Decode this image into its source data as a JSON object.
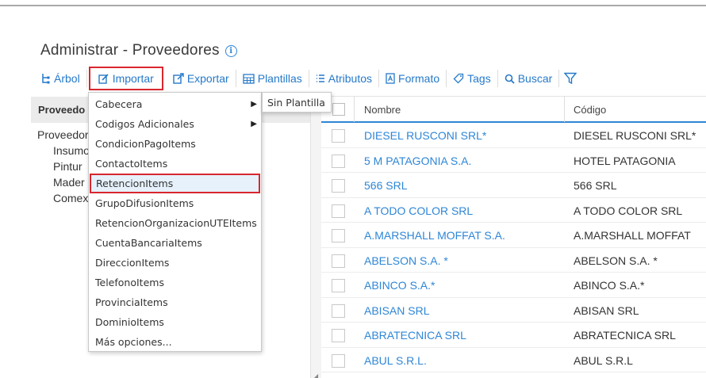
{
  "page": {
    "title": "Administrar - Proveedores"
  },
  "toolbar": {
    "arbol": "Árbol",
    "importar": "Importar",
    "exportar": "Exportar",
    "plantillas": "Plantillas",
    "atributos": "Atributos",
    "formato": "Formato",
    "tags": "Tags",
    "buscar": "Buscar",
    "accent": "#2579c9",
    "highlight": "#d9272e"
  },
  "tree": {
    "header": "Proveedo",
    "root": "Proveedor",
    "children": [
      "Insumo",
      "Pintur",
      "Mader",
      "Comex"
    ]
  },
  "grid": {
    "columns": [
      "Nombre",
      "Código"
    ],
    "rows": [
      {
        "name": "DIESEL RUSCONI SRL*",
        "code": "DIESEL RUSCONI SRL*"
      },
      {
        "name": "5 M PATAGONIA S.A.",
        "code": "HOTEL PATAGONIA"
      },
      {
        "name": "566 SRL",
        "code": "566 SRL"
      },
      {
        "name": "A TODO COLOR SRL",
        "code": "A TODO COLOR SRL"
      },
      {
        "name": "A.MARSHALL MOFFAT S.A.",
        "code": "A.MARSHALL MOFFAT"
      },
      {
        "name": "ABELSON S.A. *",
        "code": "ABELSON S.A. *"
      },
      {
        "name": "ABINCO S.A.*",
        "code": "ABINCO S.A.*"
      },
      {
        "name": "ABISAN SRL",
        "code": "ABISAN SRL"
      },
      {
        "name": "ABRATECNICA SRL",
        "code": "ABRATECNICA SRL"
      },
      {
        "name": "ABUL S.R.L.",
        "code": "ABUL S.R.L"
      }
    ]
  },
  "menu": {
    "items": [
      {
        "label": "Cabecera",
        "has_submenu": true
      },
      {
        "label": "Codigos Adicionales",
        "has_submenu": true
      },
      {
        "label": "CondicionPagoItems"
      },
      {
        "label": "ContactoItems"
      },
      {
        "label": "RetencionItems",
        "selected": true
      },
      {
        "label": "GrupoDifusionItems"
      },
      {
        "label": "RetencionOrganizacionUTEItems"
      },
      {
        "label": "CuentaBancariaItems"
      },
      {
        "label": "DireccionItems"
      },
      {
        "label": "TelefonoItems"
      },
      {
        "label": "ProvinciaItems"
      },
      {
        "label": "DominioItems"
      },
      {
        "label": "Más opciones..."
      }
    ],
    "submenu_label": "Sin Plantilla"
  }
}
